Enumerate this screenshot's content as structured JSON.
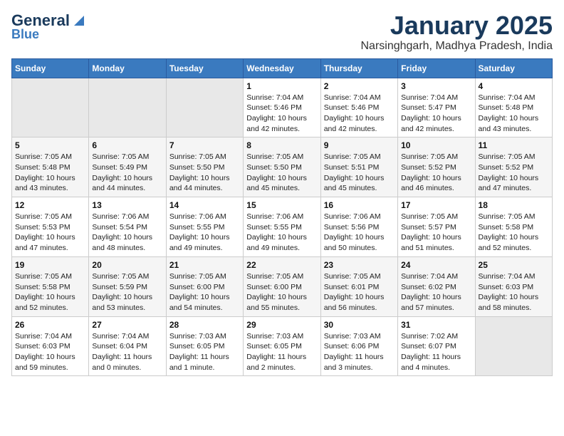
{
  "header": {
    "logo_general": "General",
    "logo_blue": "Blue",
    "title": "January 2025",
    "subtitle": "Narsinghgarh, Madhya Pradesh, India"
  },
  "calendar": {
    "days_of_week": [
      "Sunday",
      "Monday",
      "Tuesday",
      "Wednesday",
      "Thursday",
      "Friday",
      "Saturday"
    ],
    "weeks": [
      [
        {
          "day": "",
          "info": ""
        },
        {
          "day": "",
          "info": ""
        },
        {
          "day": "",
          "info": ""
        },
        {
          "day": "1",
          "info": "Sunrise: 7:04 AM\nSunset: 5:46 PM\nDaylight: 10 hours\nand 42 minutes."
        },
        {
          "day": "2",
          "info": "Sunrise: 7:04 AM\nSunset: 5:46 PM\nDaylight: 10 hours\nand 42 minutes."
        },
        {
          "day": "3",
          "info": "Sunrise: 7:04 AM\nSunset: 5:47 PM\nDaylight: 10 hours\nand 42 minutes."
        },
        {
          "day": "4",
          "info": "Sunrise: 7:04 AM\nSunset: 5:48 PM\nDaylight: 10 hours\nand 43 minutes."
        }
      ],
      [
        {
          "day": "5",
          "info": "Sunrise: 7:05 AM\nSunset: 5:48 PM\nDaylight: 10 hours\nand 43 minutes."
        },
        {
          "day": "6",
          "info": "Sunrise: 7:05 AM\nSunset: 5:49 PM\nDaylight: 10 hours\nand 44 minutes."
        },
        {
          "day": "7",
          "info": "Sunrise: 7:05 AM\nSunset: 5:50 PM\nDaylight: 10 hours\nand 44 minutes."
        },
        {
          "day": "8",
          "info": "Sunrise: 7:05 AM\nSunset: 5:50 PM\nDaylight: 10 hours\nand 45 minutes."
        },
        {
          "day": "9",
          "info": "Sunrise: 7:05 AM\nSunset: 5:51 PM\nDaylight: 10 hours\nand 45 minutes."
        },
        {
          "day": "10",
          "info": "Sunrise: 7:05 AM\nSunset: 5:52 PM\nDaylight: 10 hours\nand 46 minutes."
        },
        {
          "day": "11",
          "info": "Sunrise: 7:05 AM\nSunset: 5:52 PM\nDaylight: 10 hours\nand 47 minutes."
        }
      ],
      [
        {
          "day": "12",
          "info": "Sunrise: 7:05 AM\nSunset: 5:53 PM\nDaylight: 10 hours\nand 47 minutes."
        },
        {
          "day": "13",
          "info": "Sunrise: 7:06 AM\nSunset: 5:54 PM\nDaylight: 10 hours\nand 48 minutes."
        },
        {
          "day": "14",
          "info": "Sunrise: 7:06 AM\nSunset: 5:55 PM\nDaylight: 10 hours\nand 49 minutes."
        },
        {
          "day": "15",
          "info": "Sunrise: 7:06 AM\nSunset: 5:55 PM\nDaylight: 10 hours\nand 49 minutes."
        },
        {
          "day": "16",
          "info": "Sunrise: 7:06 AM\nSunset: 5:56 PM\nDaylight: 10 hours\nand 50 minutes."
        },
        {
          "day": "17",
          "info": "Sunrise: 7:05 AM\nSunset: 5:57 PM\nDaylight: 10 hours\nand 51 minutes."
        },
        {
          "day": "18",
          "info": "Sunrise: 7:05 AM\nSunset: 5:58 PM\nDaylight: 10 hours\nand 52 minutes."
        }
      ],
      [
        {
          "day": "19",
          "info": "Sunrise: 7:05 AM\nSunset: 5:58 PM\nDaylight: 10 hours\nand 52 minutes."
        },
        {
          "day": "20",
          "info": "Sunrise: 7:05 AM\nSunset: 5:59 PM\nDaylight: 10 hours\nand 53 minutes."
        },
        {
          "day": "21",
          "info": "Sunrise: 7:05 AM\nSunset: 6:00 PM\nDaylight: 10 hours\nand 54 minutes."
        },
        {
          "day": "22",
          "info": "Sunrise: 7:05 AM\nSunset: 6:00 PM\nDaylight: 10 hours\nand 55 minutes."
        },
        {
          "day": "23",
          "info": "Sunrise: 7:05 AM\nSunset: 6:01 PM\nDaylight: 10 hours\nand 56 minutes."
        },
        {
          "day": "24",
          "info": "Sunrise: 7:04 AM\nSunset: 6:02 PM\nDaylight: 10 hours\nand 57 minutes."
        },
        {
          "day": "25",
          "info": "Sunrise: 7:04 AM\nSunset: 6:03 PM\nDaylight: 10 hours\nand 58 minutes."
        }
      ],
      [
        {
          "day": "26",
          "info": "Sunrise: 7:04 AM\nSunset: 6:03 PM\nDaylight: 10 hours\nand 59 minutes."
        },
        {
          "day": "27",
          "info": "Sunrise: 7:04 AM\nSunset: 6:04 PM\nDaylight: 11 hours\nand 0 minutes."
        },
        {
          "day": "28",
          "info": "Sunrise: 7:03 AM\nSunset: 6:05 PM\nDaylight: 11 hours\nand 1 minute."
        },
        {
          "day": "29",
          "info": "Sunrise: 7:03 AM\nSunset: 6:05 PM\nDaylight: 11 hours\nand 2 minutes."
        },
        {
          "day": "30",
          "info": "Sunrise: 7:03 AM\nSunset: 6:06 PM\nDaylight: 11 hours\nand 3 minutes."
        },
        {
          "day": "31",
          "info": "Sunrise: 7:02 AM\nSunset: 6:07 PM\nDaylight: 11 hours\nand 4 minutes."
        },
        {
          "day": "",
          "info": ""
        }
      ]
    ]
  }
}
